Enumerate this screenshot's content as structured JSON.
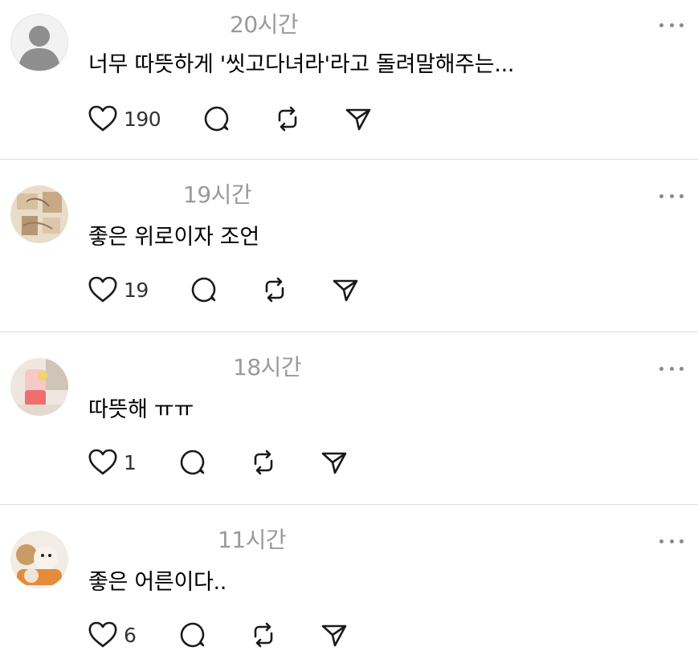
{
  "posts": [
    {
      "time": "20시간",
      "text": "너무 따뜻하게 '씻고다녀라'라고 돌려말해주는...",
      "likes": "190",
      "avatar": "default-avatar-icon"
    },
    {
      "time": "19시간",
      "text": "좋은 위로이자 조언",
      "likes": "19",
      "avatar": "user-photo-avatar"
    },
    {
      "time": "18시간",
      "text": "따뜻해 ㅠㅠ",
      "likes": "1",
      "avatar": "user-photo-avatar"
    },
    {
      "time": "11시간",
      "text": "좋은 어른이다..",
      "likes": "6",
      "avatar": "user-photo-avatar"
    }
  ],
  "icons": {
    "like": "heart-icon",
    "reply": "comment-bubble-icon",
    "repost": "repost-icon",
    "share": "send-icon",
    "menu": "more-dots-icon"
  },
  "colors": {
    "text": "#000000",
    "muted": "#9a9a9a",
    "divider": "#dcdcdc",
    "icon": "#1a1a1a"
  }
}
